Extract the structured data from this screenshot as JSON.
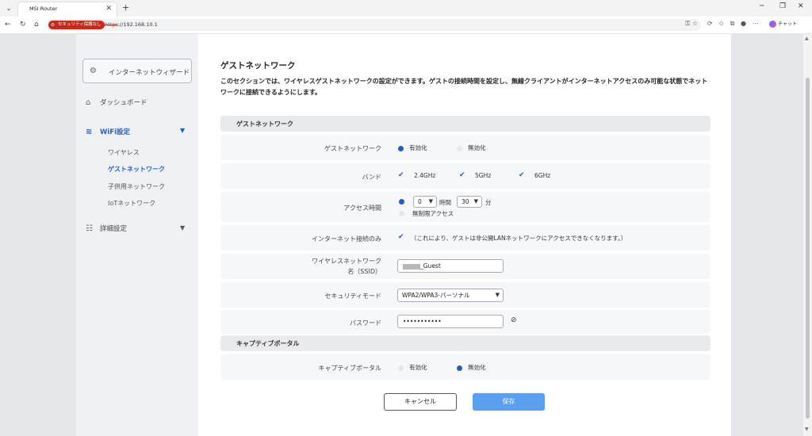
{
  "browser": {
    "tab_title": "MSI Router",
    "tab_close": "✕",
    "new_tab": "+",
    "security_badge": "セキュリティ保護なし",
    "url_protocol": "https",
    "url_rest": "://192.168.10.1",
    "chat_label": "チャット",
    "win_min": "─",
    "win_max": "❐",
    "win_close": "✕"
  },
  "sidebar": {
    "wizard_label": "インターネットウィザード",
    "dashboard_label": "ダッシュボード",
    "wifi_label": "WiFi設定",
    "sub_items": [
      "ワイヤレス",
      "ゲストネットワーク",
      "子供用ネットワーク",
      "IoTネットワーク"
    ],
    "advanced_label": "詳細設定"
  },
  "main": {
    "title": "ゲストネットワーク",
    "description": "このセクションでは、ワイヤレスゲストネットワークの設定ができます。ゲストの接続時間を設定し、無線クライアントがインターネットアクセスのみ可能な状態でネットワークに接続できるようにします。",
    "section_guest": "ゲストネットワーク",
    "guest_network_label": "ゲストネットワーク",
    "enable": "有効化",
    "disable": "無効化",
    "guest_network_enabled": true,
    "band_label": "バンド",
    "bands": [
      "2.4GHz",
      "5GHz",
      "6GHz"
    ],
    "access_time_label": "アクセス時間",
    "hours_value": "0",
    "hours_unit": "時間",
    "minutes_value": "30",
    "minutes_unit": "分",
    "unlimited_access": "無制限アクセス",
    "internet_only_label": "インターネット接続のみ",
    "internet_only_note": "（これにより、ゲストは非公開LANネットワークにアクセスできなくなります。）",
    "ssid_label_line1": "ワイヤレスネットワーク",
    "ssid_label_line2": "名（SSID）",
    "ssid_value": "_Guest",
    "security_mode_label": "セキュリティモード",
    "security_mode_value": "WPA2/WPA3-パーソナル",
    "password_label": "パスワード",
    "password_value": "•••••••••••",
    "section_captive": "キャプティブポータル",
    "captive_label": "キャプティブポータル",
    "captive_enabled": false,
    "cancel_button": "キャンセル",
    "save_button": "保存"
  },
  "colors": {
    "accent": "#1f5fc9",
    "save_button": "#5b9ff0",
    "insecure_badge": "#c42b1c"
  }
}
